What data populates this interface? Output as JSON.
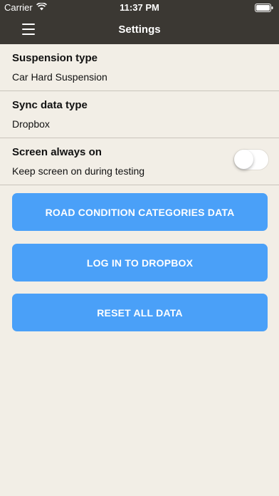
{
  "status_bar": {
    "carrier": "Carrier",
    "time": "11:37 PM"
  },
  "nav": {
    "title": "Settings"
  },
  "settings": [
    {
      "label": "Suspension type",
      "value": "Car Hard Suspension"
    },
    {
      "label": "Sync data type",
      "value": "Dropbox"
    },
    {
      "label": "Screen always on",
      "value": "Keep screen on during testing",
      "toggle_on": false
    }
  ],
  "buttons": {
    "road_condition": "ROAD CONDITION CATEGORIES DATA",
    "login_dropbox": "LOG IN TO DROPBOX",
    "reset": "RESET ALL DATA"
  },
  "colors": {
    "accent": "#4aa0f8",
    "header": "#3b3833",
    "background": "#f2eee6"
  }
}
